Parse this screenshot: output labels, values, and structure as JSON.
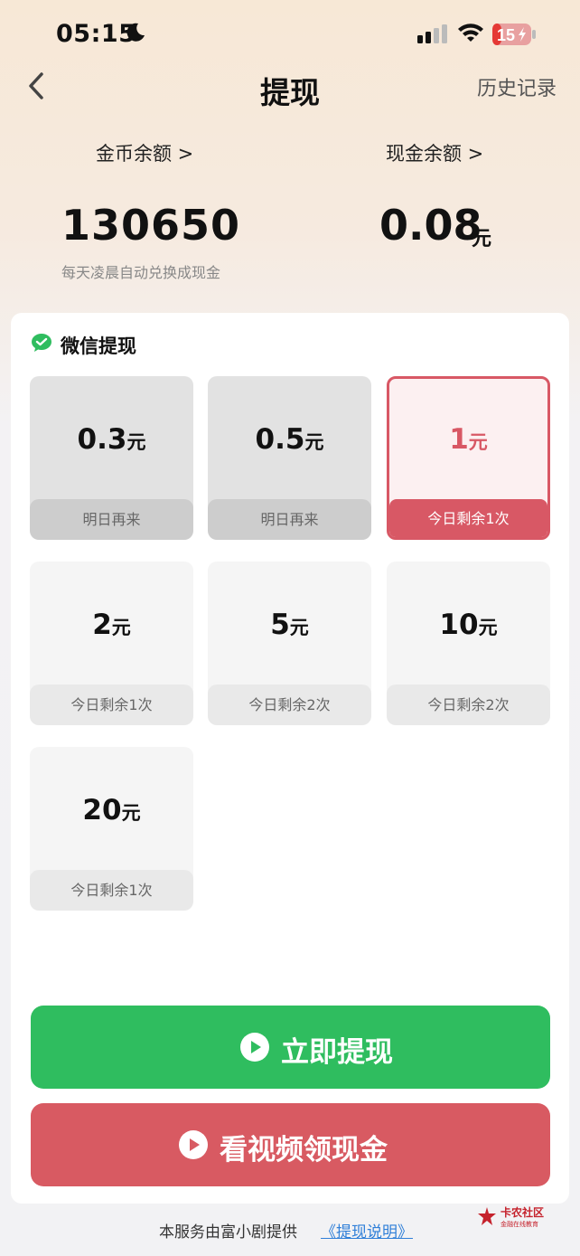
{
  "status_bar": {
    "time": "05:15",
    "battery": "15"
  },
  "nav": {
    "title": "提现",
    "history": "历史记录"
  },
  "balances": {
    "coins_label": "金币余额 >",
    "cash_label": "现金余额 >",
    "coins_value": "130650",
    "cash_value": "0.08",
    "cash_unit": "元",
    "note": "每天凌晨自动兑换成现金"
  },
  "withdraw": {
    "method": "微信提现",
    "unit": "元",
    "options": [
      {
        "amount": "0.3",
        "status": "明日再来",
        "state": "disabled"
      },
      {
        "amount": "0.5",
        "status": "明日再来",
        "state": "disabled"
      },
      {
        "amount": "1",
        "status": "今日剩余1次",
        "state": "selected"
      },
      {
        "amount": "2",
        "status": "今日剩余1次",
        "state": "available"
      },
      {
        "amount": "5",
        "status": "今日剩余2次",
        "state": "available"
      },
      {
        "amount": "10",
        "status": "今日剩余2次",
        "state": "available"
      },
      {
        "amount": "20",
        "status": "今日剩余1次",
        "state": "available"
      }
    ]
  },
  "buttons": {
    "withdraw_now": "立即提现",
    "watch_video": "看视频领现金"
  },
  "footer": {
    "text": "本服务由富小剧提供",
    "link": "《提现说明》"
  },
  "watermark": {
    "name": "卡农社区",
    "sub": "金融在线教育"
  },
  "colors": {
    "green": "#2fbd5f",
    "red": "#d85a62",
    "accent": "#d85865"
  }
}
